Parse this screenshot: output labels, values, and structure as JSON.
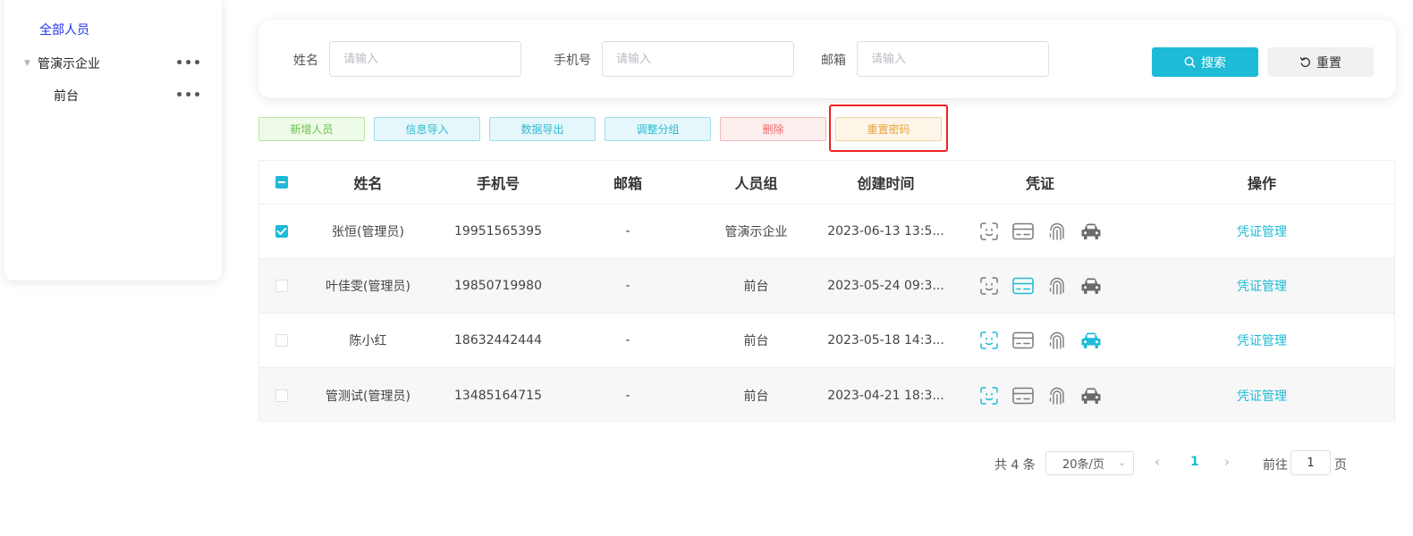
{
  "sidebar": {
    "root_label": "全部人员",
    "company_label": "管演示企业",
    "front_label": "前台",
    "more_glyph": "•••",
    "caret_glyph": "▼"
  },
  "search": {
    "name_label": "姓名",
    "phone_label": "手机号",
    "email_label": "邮箱",
    "placeholder": "请输入",
    "search_button": "搜索",
    "reset_button": "重置"
  },
  "actions": {
    "add": "新增人员",
    "import": "信息导入",
    "export": "数据导出",
    "group": "调整分组",
    "delete": "删除",
    "reset_password": "重置密码"
  },
  "table": {
    "headers": {
      "name": "姓名",
      "phone": "手机号",
      "email": "邮箱",
      "group": "人员组",
      "created": "创建时间",
      "credentials": "凭证",
      "operation": "操作"
    },
    "rows": [
      {
        "checked": true,
        "name": "张恒(管理员)",
        "phone": "19951565395",
        "email": "-",
        "group": "管演示企业",
        "created": "2023-06-13 13:5...",
        "face": false,
        "card": false,
        "finger": false,
        "car": false,
        "op": "凭证管理"
      },
      {
        "checked": false,
        "name": "叶佳雯(管理员)",
        "phone": "19850719980",
        "email": "-",
        "group": "前台",
        "created": "2023-05-24 09:3...",
        "face": false,
        "card": true,
        "finger": false,
        "car": false,
        "op": "凭证管理"
      },
      {
        "checked": false,
        "name": "陈小红",
        "phone": "18632442444",
        "email": "-",
        "group": "前台",
        "created": "2023-05-18 14:3...",
        "face": true,
        "card": false,
        "finger": false,
        "car": true,
        "op": "凭证管理"
      },
      {
        "checked": false,
        "name": "管测试(管理员)",
        "phone": "13485164715",
        "email": "-",
        "group": "前台",
        "created": "2023-04-21 18:3...",
        "face": true,
        "card": false,
        "finger": false,
        "car": false,
        "op": "凭证管理"
      }
    ]
  },
  "pagination": {
    "total": "共 4 条",
    "page_size": "20条/页",
    "prev_glyph": "‹",
    "current_page": "1",
    "next_glyph": "›",
    "goto_label": "前往",
    "goto_value": "1",
    "unit_label": "页"
  },
  "colors": {
    "accent": "#1dbbd6",
    "inactive_icon": "#7a7a7a",
    "car_inactive": "#6b6b6b",
    "highlight": "#ee2222"
  },
  "icons": {
    "face": "face-scan-icon",
    "card": "id-card-icon",
    "finger": "fingerprint-icon",
    "car": "car-icon",
    "search": "search-icon",
    "reset": "refresh-icon"
  }
}
